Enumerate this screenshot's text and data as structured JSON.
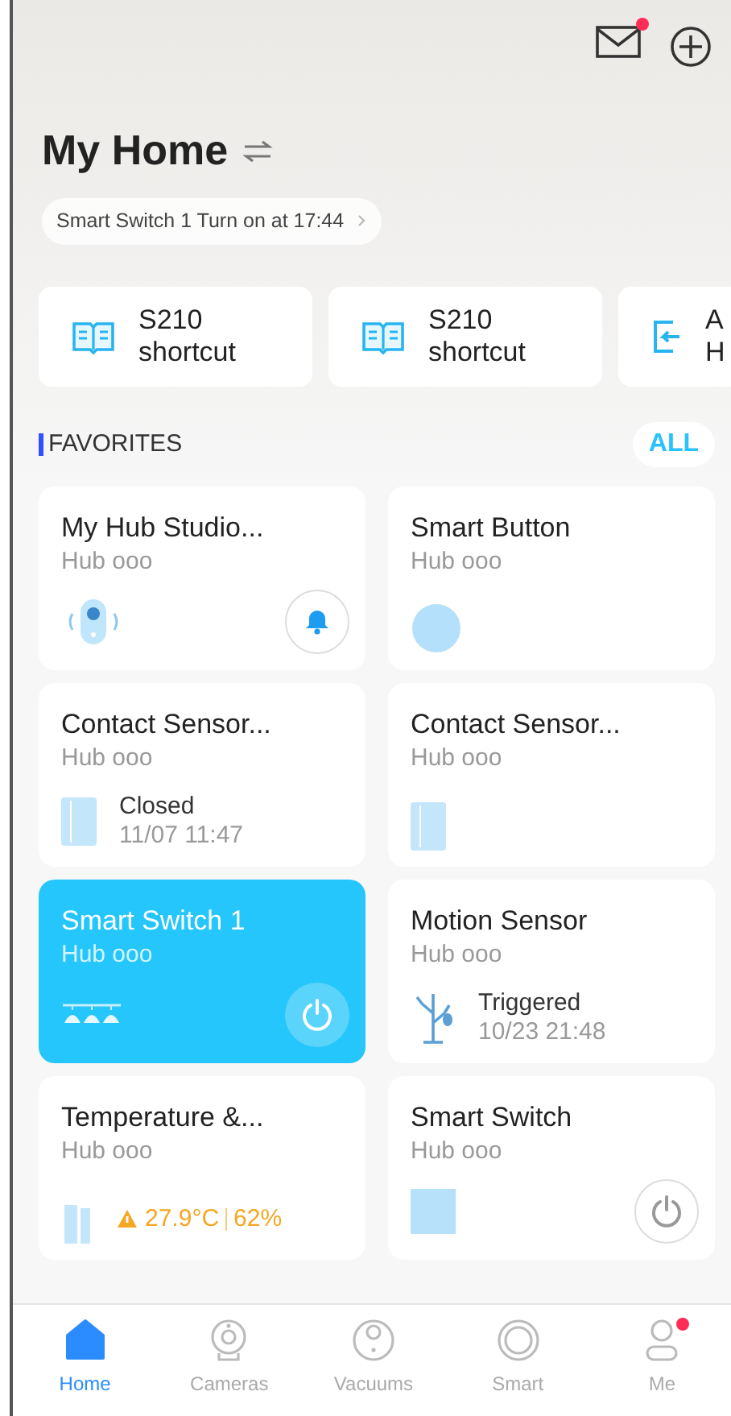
{
  "header": {
    "title": "My Home",
    "mail_badge": true,
    "notice": "Smart Switch 1 Turn on at 17:44"
  },
  "shortcuts": [
    {
      "kind": "book",
      "lines": [
        "S210",
        "shortcut"
      ]
    },
    {
      "kind": "book",
      "lines": [
        "S210",
        "shortcut"
      ]
    },
    {
      "kind": "exit",
      "lines": [
        "A",
        "H"
      ]
    }
  ],
  "favorites": {
    "title": "FAVORITES",
    "all_button": "ALL"
  },
  "devices": [
    {
      "kind": "hub",
      "name": "My Hub Studio...",
      "hub": "Hub ooo",
      "on": false
    },
    {
      "kind": "button",
      "name": "Smart Button",
      "hub": "Hub ooo",
      "on": false
    },
    {
      "kind": "contact",
      "name": "Contact Sensor...",
      "hub": "Hub ooo",
      "on": false,
      "status": "Closed",
      "time": "11/07 11:47"
    },
    {
      "kind": "contact",
      "name": "Contact Sensor...",
      "hub": "Hub ooo",
      "on": false
    },
    {
      "kind": "switch",
      "name": "Smart Switch 1",
      "hub": "Hub ooo",
      "on": true
    },
    {
      "kind": "motion",
      "name": "Motion Sensor",
      "hub": "Hub ooo",
      "on": false,
      "status": "Triggered",
      "time": "10/23 21:48"
    },
    {
      "kind": "temp",
      "name": "Temperature &...",
      "hub": "Hub ooo",
      "on": false,
      "temperature": "27.9°C",
      "humidity": "62%"
    },
    {
      "kind": "plug",
      "name": "Smart Switch",
      "hub": "Hub ooo",
      "on": false
    }
  ],
  "tabs": [
    {
      "label": "Home",
      "kind": "home",
      "selected": true,
      "badge": false
    },
    {
      "label": "Cameras",
      "kind": "camera",
      "selected": false,
      "badge": false
    },
    {
      "label": "Vacuums",
      "kind": "vacuum",
      "selected": false,
      "badge": false
    },
    {
      "label": "Smart",
      "kind": "smart",
      "selected": false,
      "badge": false
    },
    {
      "label": "Me",
      "kind": "me",
      "selected": false,
      "badge": true
    }
  ]
}
